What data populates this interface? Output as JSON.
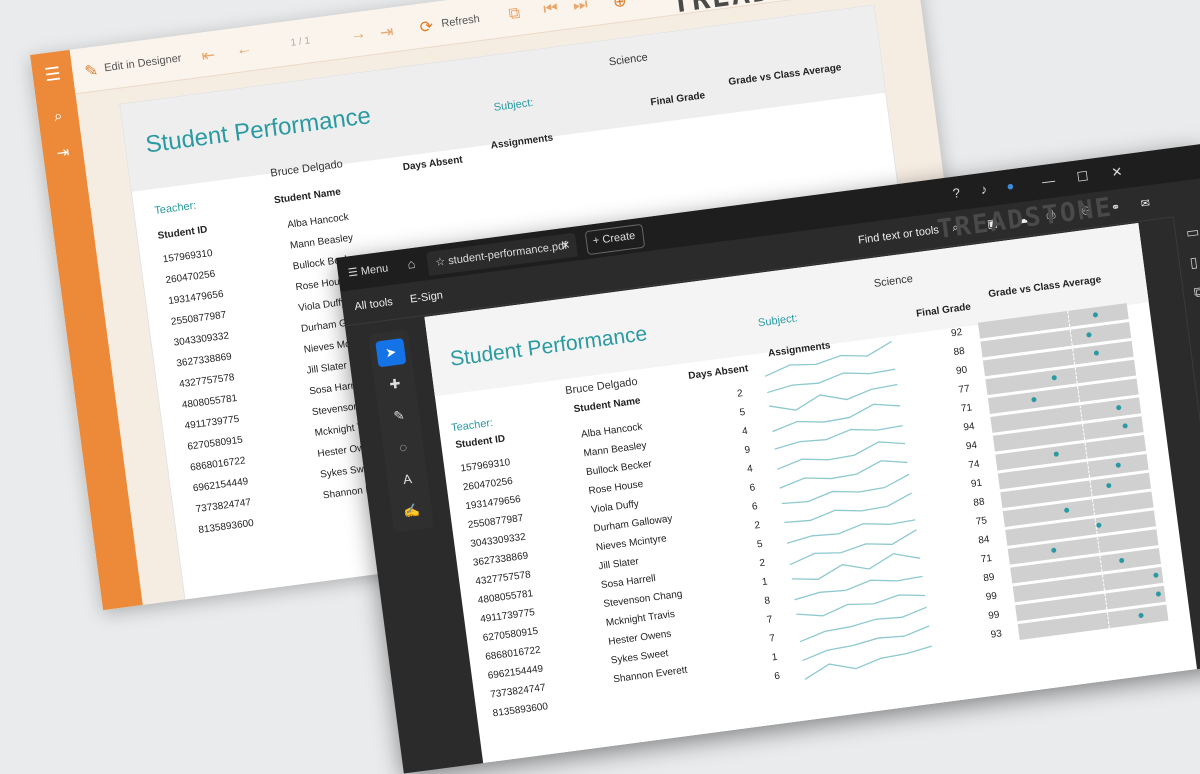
{
  "back_viewer": {
    "toolbar": {
      "edit_label": "Edit in Designer",
      "page_indicator": "1 / 1",
      "refresh_label": "Refresh"
    },
    "report": {
      "logo": "TREADSTONE",
      "title": "Student Performance",
      "subject_label": "Subject:",
      "subject_value": "Science",
      "teacher_label": "Teacher:",
      "teacher_value": "Bruce Delgado",
      "columns": [
        "Student ID",
        "Student Name",
        "Days Absent",
        "Assignments",
        "Final Grade",
        "Grade vs Class Average"
      ],
      "student_ids": [
        "157969310",
        "260470256",
        "1931479656",
        "2550877987",
        "3043309332",
        "3627338869",
        "4327757578",
        "4808055781",
        "4911739775",
        "6270580915",
        "6868016722",
        "6962154449",
        "7373824747",
        "8135893600"
      ],
      "student_names": [
        "Alba Hancock",
        "Mann Beasley",
        "Bullock Becker",
        "Rose House",
        "Viola Duffy",
        "Durham Galloway",
        "Nieves Mcintyre",
        "Jill Slater",
        "Sosa Harrell",
        "Stevenson Chang",
        "Mcknight Travis",
        "Hester Owens",
        "Sykes Sweet",
        "Shannon Everett"
      ]
    }
  },
  "front_viewer": {
    "titlebar": {
      "menu_label": "Menu",
      "tab_title": "student-performance.pdf",
      "create_label": "Create"
    },
    "toolsbar": {
      "all_tools": "All tools",
      "esign": "E-Sign",
      "search_placeholder": "Find text or tools"
    },
    "report": {
      "logo": "TREADSTONE",
      "title": "Student Performance",
      "subject_label": "Subject:",
      "subject_value": "Science",
      "teacher_label": "Teacher:",
      "teacher_value": "Bruce Delgado",
      "headers": {
        "id": "Student ID",
        "name": "Student Name",
        "absent": "Days Absent",
        "assignments": "Assignments",
        "grade": "Final Grade",
        "vs_avg": "Grade vs Class Average"
      },
      "rows": [
        {
          "id": "157969310",
          "name": "Alba Hancock",
          "absent": "2",
          "grade": "92",
          "vs": 0.78
        },
        {
          "id": "260470256",
          "name": "Mann Beasley",
          "absent": "5",
          "grade": "88",
          "vs": 0.72
        },
        {
          "id": "1931479656",
          "name": "Bullock Becker",
          "absent": "4",
          "grade": "90",
          "vs": 0.75
        },
        {
          "id": "2550877987",
          "name": "Rose House",
          "absent": "9",
          "grade": "77",
          "vs": 0.45
        },
        {
          "id": "3043309332",
          "name": "Viola Duffy",
          "absent": "4",
          "grade": "71",
          "vs": 0.3
        },
        {
          "id": "3627338869",
          "name": "Durham Galloway",
          "absent": "6",
          "grade": "94",
          "vs": 0.85
        },
        {
          "id": "4327757578",
          "name": "Nieves Mcintyre",
          "absent": "6",
          "grade": "94",
          "vs": 0.88
        },
        {
          "id": "4808055781",
          "name": "Jill Slater",
          "absent": "2",
          "grade": "74",
          "vs": 0.4
        },
        {
          "id": "4911739775",
          "name": "Sosa Harrell",
          "absent": "5",
          "grade": "91",
          "vs": 0.8
        },
        {
          "id": "6270580915",
          "name": "Stevenson Chang",
          "absent": "2",
          "grade": "88",
          "vs": 0.72
        },
        {
          "id": "6868016722",
          "name": "Mcknight Travis",
          "absent": "1",
          "grade": "75",
          "vs": 0.42
        },
        {
          "id": "6962154449",
          "name": "Hester Owens",
          "absent": "8",
          "grade": "84",
          "vs": 0.62
        },
        {
          "id": "7373824747",
          "name": "Sykes Sweet",
          "absent": "7",
          "grade": "71",
          "vs": 0.3
        },
        {
          "id": "8135893600",
          "name": "Shannon Everett",
          "absent": "7",
          "grade": "89",
          "vs": 0.74
        },
        {
          "id": "",
          "name": "",
          "absent": "1",
          "grade": "99",
          "vs": 0.95
        },
        {
          "id": "",
          "name": "",
          "absent": "6",
          "grade": "99",
          "vs": 0.95
        },
        {
          "id": "",
          "name": "",
          "absent": "",
          "grade": "93",
          "vs": 0.82
        }
      ]
    }
  },
  "colors": {
    "accent_teal": "#2a9aa2",
    "accent_orange": "#ec8a3a",
    "dark_bg": "#2b2b2b"
  }
}
